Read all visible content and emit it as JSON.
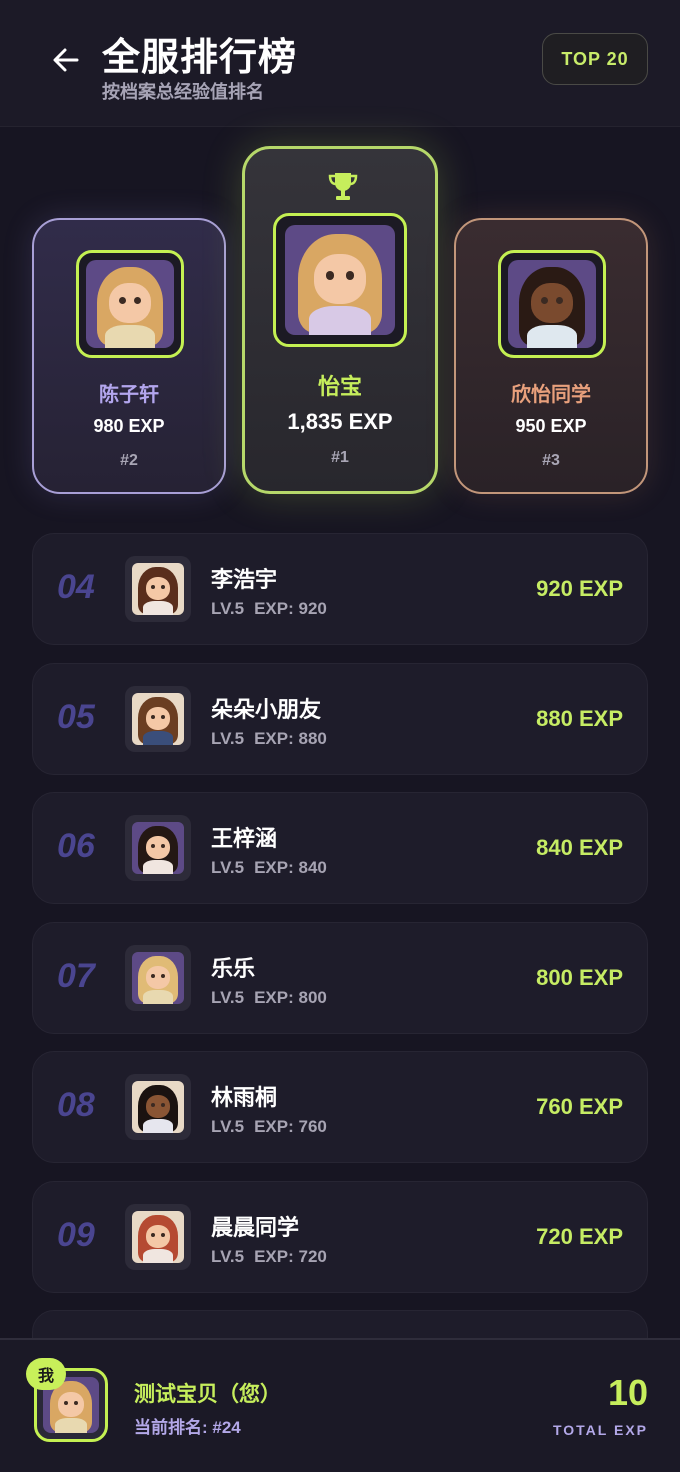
{
  "header": {
    "title": "全服排行榜",
    "subtitle": "按档案总经验值排名",
    "badge": "TOP 20"
  },
  "podium": [
    {
      "name": "陈子轩",
      "exp": "980 EXP",
      "rank": "#2",
      "hair": "#d9a763",
      "skin": "#f4c8a6",
      "body": "#e8d9b0",
      "bg": "#5d4a86"
    },
    {
      "name": "怡宝",
      "exp": "1,835 EXP",
      "rank": "#1",
      "hair": "#d9a763",
      "skin": "#f4c8a6",
      "body": "#d8c9e6",
      "bg": "#5d4a86"
    },
    {
      "name": "欣怡同学",
      "exp": "950 EXP",
      "rank": "#3",
      "hair": "#2a1a14",
      "skin": "#7a4a2e",
      "body": "#dfe8ef",
      "bg": "#5d4a86"
    }
  ],
  "list": [
    {
      "rank": "04",
      "name": "李浩宇",
      "level": "LV.5",
      "exp_meta": "EXP: 920",
      "exp": "920 EXP",
      "hair": "#5a2e1c",
      "skin": "#f4c8a6",
      "body": "#f0e6e0",
      "bg": "#e8d9c6"
    },
    {
      "rank": "05",
      "name": "朵朵小朋友",
      "level": "LV.5",
      "exp_meta": "EXP: 880",
      "exp": "880 EXP",
      "hair": "#6b3e22",
      "skin": "#f4c8a6",
      "body": "#3a4e7a",
      "bg": "#e8d9c6"
    },
    {
      "rank": "06",
      "name": "王梓涵",
      "level": "LV.5",
      "exp_meta": "EXP: 840",
      "exp": "840 EXP",
      "hair": "#241814",
      "skin": "#f4c8a6",
      "body": "#f0e6e0",
      "bg": "#5d4a86"
    },
    {
      "rank": "07",
      "name": "乐乐",
      "level": "LV.5",
      "exp_meta": "EXP: 800",
      "exp": "800 EXP",
      "hair": "#e0bb76",
      "skin": "#f4c8a6",
      "body": "#e8d9b0",
      "bg": "#5d4a86"
    },
    {
      "rank": "08",
      "name": "林雨桐",
      "level": "LV.5",
      "exp_meta": "EXP: 760",
      "exp": "760 EXP",
      "hair": "#1a1210",
      "skin": "#8a5534",
      "body": "#e6e6ee",
      "bg": "#e8d9c6"
    },
    {
      "rank": "09",
      "name": "晨晨同学",
      "level": "LV.5",
      "exp_meta": "EXP: 720",
      "exp": "720 EXP",
      "hair": "#b54a32",
      "skin": "#f4c8a6",
      "body": "#f0e6e0",
      "bg": "#e8d9c6"
    }
  ],
  "me": {
    "badge": "我",
    "name": "测试宝贝（您）",
    "rank": "当前排名: #24",
    "total": "10",
    "total_label": "TOTAL EXP"
  },
  "icons": {
    "back": "arrow-left-icon",
    "trophy": "trophy-icon"
  },
  "colors": {
    "accent": "#c6ee5c",
    "silver": "#b3a6ee",
    "bronze": "#e8a07c",
    "background": "#171522"
  }
}
